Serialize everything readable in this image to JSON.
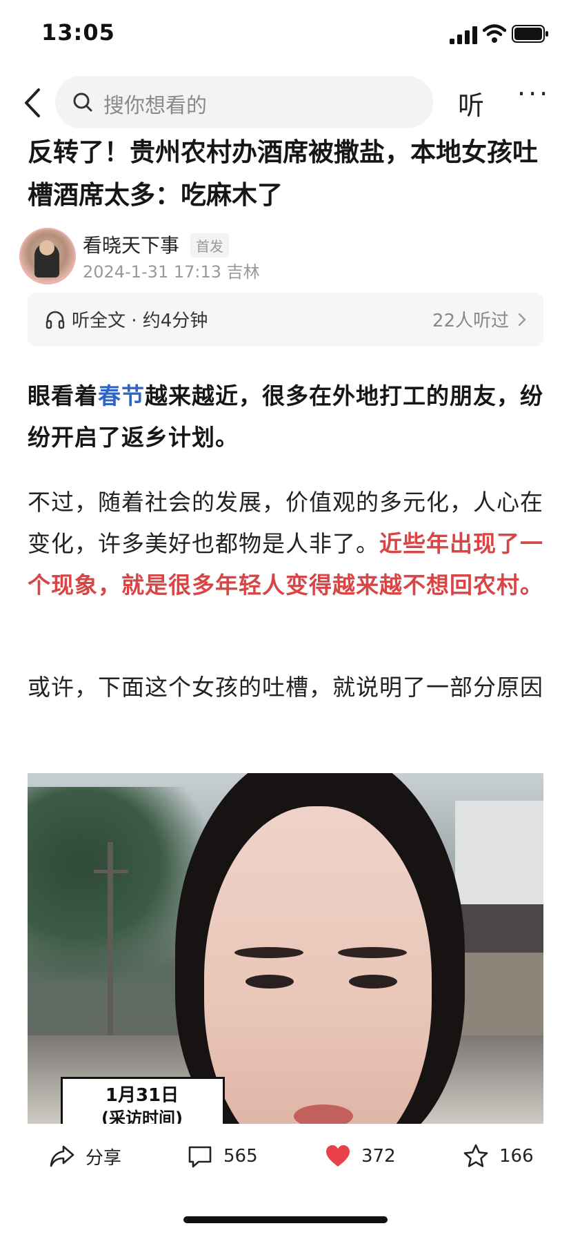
{
  "status_bar": {
    "time": "13:05"
  },
  "nav": {
    "search_placeholder": "搜你想看的",
    "listen_label": "听",
    "more_label": "···"
  },
  "article": {
    "title": "反转了！贵州农村办酒席被撒盐，本地女孩吐槽酒席太多：吃麻木了",
    "author": {
      "name": "看晓天下事",
      "badge": "首发",
      "meta": "2024-1-31  17:13  吉林"
    },
    "listen_card": {
      "label": "听全文 · 约4分钟",
      "count": "22人听过"
    },
    "paragraph1": {
      "before": "眼看着",
      "link": "春节",
      "after": "越来越近，很多在外地打工的朋友，纷纷开启了返乡计划。"
    },
    "paragraph2": {
      "normal": "不过，随着社会的发展，价值观的多元化，人心在变化，许多美好也都物是人非了。",
      "highlight": "近些年出现了一个现象，就是很多年轻人变得越来越不想回农村。"
    },
    "paragraph3": "或许，下面这个女孩的吐槽，就说明了一部分原因",
    "image_caption": {
      "date": "1月31日",
      "sub": "(采访时间)"
    }
  },
  "actions": {
    "share_label": "分享",
    "comment_count": "565",
    "like_count": "372",
    "favorite_count": "166"
  },
  "colors": {
    "link": "#2e66c7",
    "highlight": "#d94545",
    "like": "#e8414b"
  }
}
